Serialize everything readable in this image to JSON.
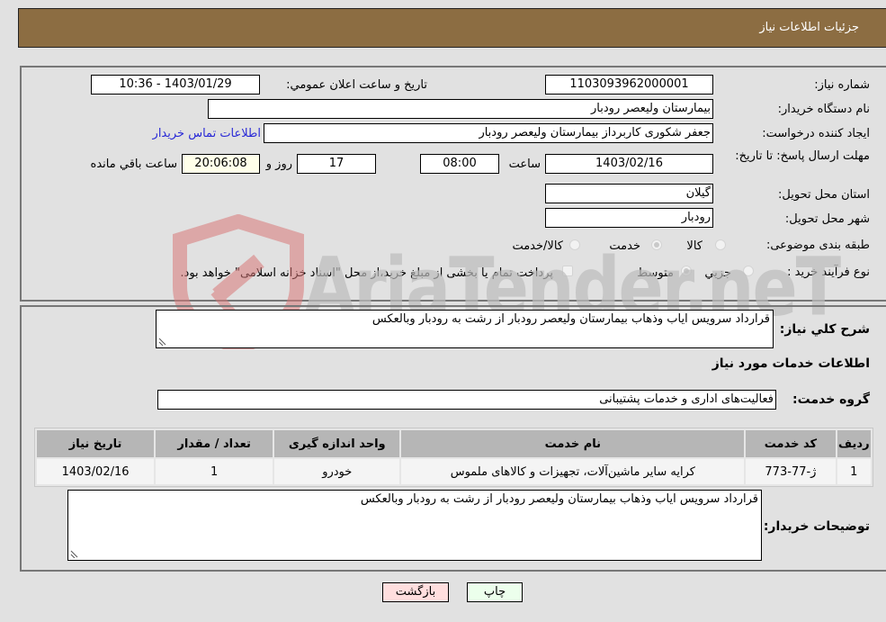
{
  "header": {
    "title": "جزئیات اطلاعات نیاز"
  },
  "form": {
    "need_number": {
      "label": "شماره نیاز:",
      "value": "1103093962000001"
    },
    "announce_datetime": {
      "label": "تاریخ و ساعت اعلان عمومي:",
      "value": "1403/01/29 - 10:36"
    },
    "buyer_org": {
      "label": "نام دستگاه خریدار:",
      "value": "بیمارستان ولیعصر رودبار"
    },
    "requester": {
      "label": "ایجاد کننده درخواست:",
      "value": "جعفر شکوری کاربرداز بیمارستان ولیعصر رودبار"
    },
    "buyer_contact_link": "اطلاعات تماس خریدار",
    "deadline": {
      "label": "مهلت ارسال پاسخ: تا تاریخ:",
      "date": "1403/02/16",
      "time_label": "ساعت",
      "time": "08:00",
      "days": "17",
      "days_label": "روز و",
      "remaining": "20:06:08",
      "remaining_label": "ساعت باقي مانده"
    },
    "province": {
      "label": "استان محل تحویل:",
      "value": "گیلان"
    },
    "city": {
      "label": "شهر محل تحویل:",
      "value": "رودبار"
    },
    "category": {
      "label": "طبقه بندی موضوعی:",
      "options": [
        "کالا",
        "خدمت",
        "کالا/خدمت"
      ],
      "selected": "خدمت"
    },
    "purchase_type": {
      "label": "نوع فرآیند خرید :",
      "options": [
        "جزیي",
        "متوسط"
      ],
      "selected": "متوسط",
      "treasury_note": "پرداخت تمام یا بخشی از مبلغ خرید،از محل \"اسناد خزانه اسلامی\" خواهد بود."
    }
  },
  "details": {
    "summary_label": "شرح كلي نیاز:",
    "summary": "قرارداد سرویس ایاب وذهاب بیمارستان ولیعصر رودبار از رشت به رودبار وبالعکس",
    "services_heading": "اطلاعات خدمات مورد نیاز",
    "service_group_label": "گروه خدمت:",
    "service_group": "فعالیت‌های اداری و خدمات پشتیبانی",
    "table": {
      "headers": [
        "ردیف",
        "کد خدمت",
        "نام خدمت",
        "واحد اندازه گیری",
        "تعداد / مقدار",
        "تاریخ نیاز"
      ],
      "rows": [
        [
          "1",
          "ژ-77-773",
          "کرایه سایر ماشین‌آلات، تجهیزات و کالاهای ملموس",
          "خودرو",
          "1",
          "1403/02/16"
        ]
      ]
    },
    "buyer_notes_label": "توضیحات خریدار:",
    "buyer_notes": "قرارداد سرویس ایاب وذهاب بیمارستان ولیعصر رودبار از رشت به رودبار وبالعکس"
  },
  "buttons": {
    "print": "چاپ",
    "back": "بازگشت"
  },
  "watermark": {
    "text": "AriaTender.neT",
    "icon": "shield-gavel-icon"
  }
}
